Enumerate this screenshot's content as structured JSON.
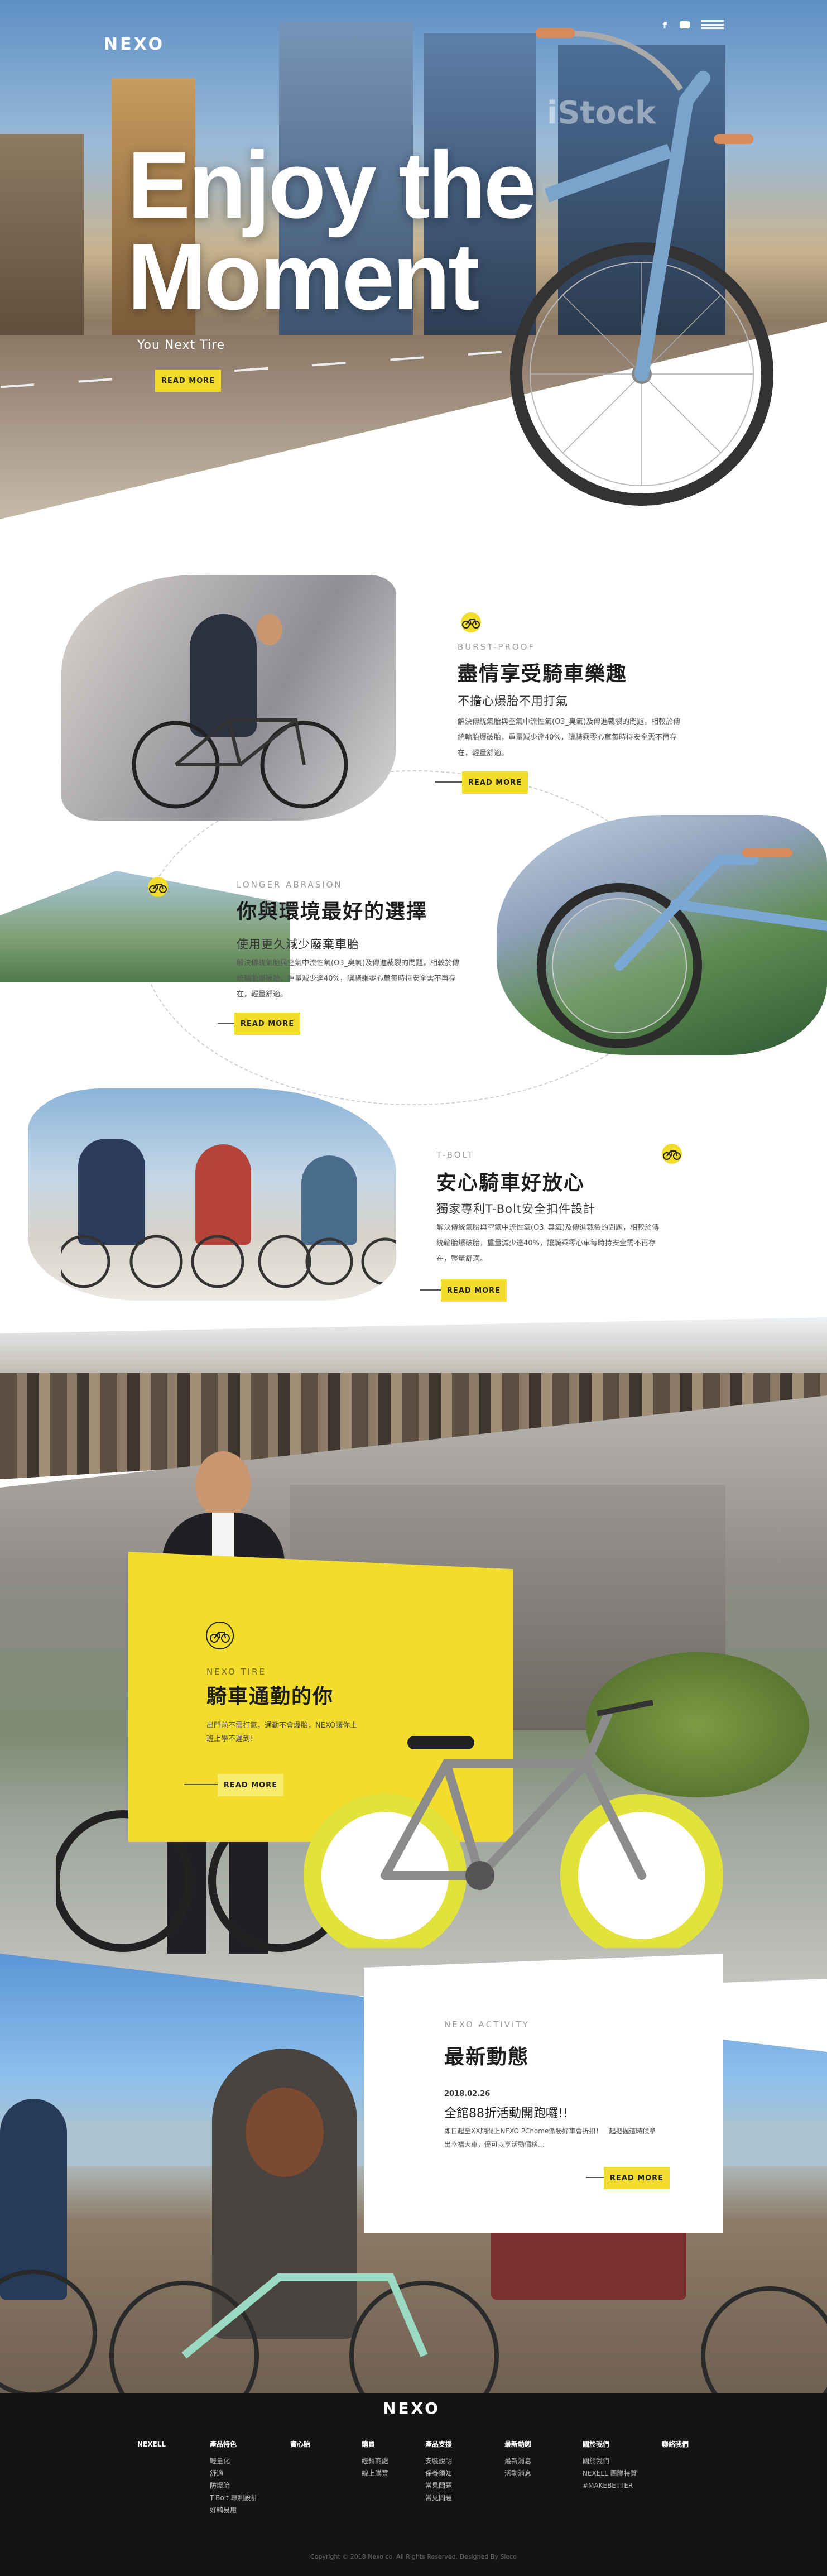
{
  "header": {
    "logo": "NEXO",
    "icons": [
      "facebook-icon",
      "youtube-icon",
      "menu-icon"
    ]
  },
  "hero": {
    "title_line1": "Enjoy the",
    "title_line2": "Moment",
    "tagline": "You Next Tire",
    "button": "READ MORE"
  },
  "features": [
    {
      "sub": "BURST-PROOF",
      "title": "盡情享受騎車樂趣",
      "subtitle": "不擔心爆胎不用打氣",
      "body": "解決傳統氣胎與空氣中流性氧(O3_臭氧)及傳進裁裂的問題，相較於傳統輪胎爆破胎，重量減少達40%，讓騎乘零心車每時持安全需不再存在，輕量舒適。",
      "button": "READ MORE"
    },
    {
      "sub": "LONGER ABRASION",
      "title": "你與環境最好的選擇",
      "subtitle": "使用更久減少廢棄車胎",
      "body": "解決傳統氣胎與空氣中流性氧(O3_臭氧)及傳進裁裂的問題，相較於傳統輪胎爆破胎，重量減少達40%，讓騎乘零心車每時持安全需不再存在，輕量舒適。",
      "button": "READ MORE"
    },
    {
      "sub": "T-BOLT",
      "title": "安心騎車好放心",
      "subtitle": "獨家專利T-Bolt安全扣件設計",
      "body": "解決傳統氣胎與空氣中流性氧(O3_臭氧)及傳進裁裂的問題，相較於傳統輪胎爆破胎，重量減少達40%，讓騎乘零心車每時持安全需不再存在，輕量舒適。",
      "button": "READ MORE"
    }
  ],
  "commute": {
    "sub": "NEXO TIRE",
    "title": "騎車通勤的你",
    "body": "出門前不需打氣，通勤不會爆胎，NEXO讓你上班上學不遲到！",
    "button": "READ MORE"
  },
  "activity": {
    "sub": "NEXO ACTIVITY",
    "title": "最新動態",
    "date": "2018.02.26",
    "headline": "全館88折活動開跑囉!!",
    "body": "即日起至XX期間上NEXO PChome派勝好車會折扣！一起把握這時候拿出幸福大車，優可以享活動價格...",
    "button": "READ MORE"
  },
  "watermark": "iStock",
  "footer": {
    "logo": "NEXO",
    "columns": [
      {
        "head": "NEXELL",
        "items": []
      },
      {
        "head": "產品特色",
        "items": [
          "輕量化",
          "舒適",
          "防爆胎",
          "T-Bolt 專利設計",
          "好騎易用"
        ]
      },
      {
        "head": "實心胎",
        "items": []
      },
      {
        "head": "購買",
        "items": [
          "經銷商處",
          "線上購買"
        ]
      },
      {
        "head": "產品支援",
        "items": [
          "安裝說明",
          "保養須知",
          "常見問題",
          "常見問題"
        ]
      },
      {
        "head": "最新動態",
        "items": [
          "最新消息",
          "活動消息"
        ]
      },
      {
        "head": "關於我們",
        "items": [
          "關於我們",
          "NEXELL 團隊特質",
          "#MAKEBETTER"
        ]
      },
      {
        "head": "聯絡我們",
        "items": []
      }
    ],
    "copyright": "Copyright © 2018 Nexo co. All Rights Reserved.  Designed By Sieco"
  },
  "colors": {
    "accent": "#f2dc2c",
    "dark": "#141414",
    "sky": "#6fa2d0"
  }
}
